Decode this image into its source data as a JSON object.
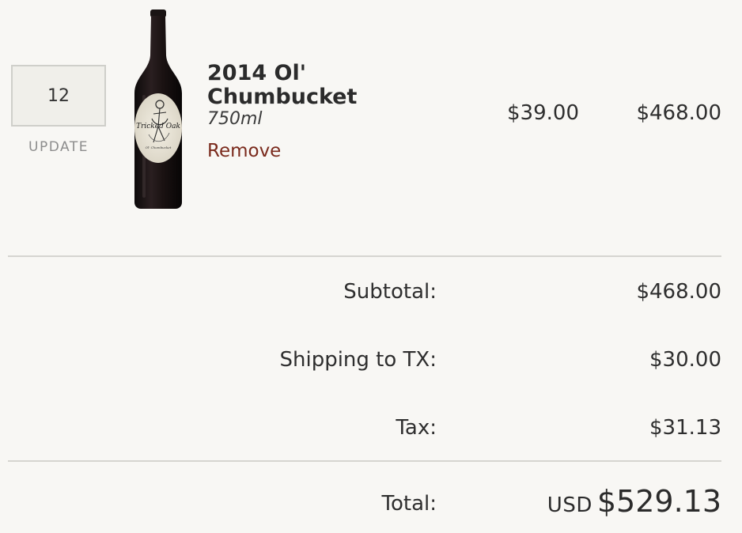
{
  "cart": {
    "item": {
      "quantity": "12",
      "update_label": "UPDATE",
      "name": "2014 Ol' Chumbucket",
      "size": "750ml",
      "remove_label": "Remove",
      "unit_price": "$39.00",
      "line_total": "$468.00",
      "label_text": "Tricked Oak",
      "label_subtext": "Ol' Chumbucket"
    },
    "summary": {
      "subtotal_label": "Subtotal:",
      "subtotal_value": "$468.00",
      "shipping_label": "Shipping to TX:",
      "shipping_value": "$30.00",
      "tax_label": "Tax:",
      "tax_value": "$31.13",
      "total_label": "Total:",
      "currency": "USD",
      "total_value": "$529.13"
    }
  },
  "colors": {
    "background": "#f8f7f4",
    "remove_link": "#7a2a1c",
    "divider": "#d6d5d0",
    "muted": "#8d8d8d"
  }
}
